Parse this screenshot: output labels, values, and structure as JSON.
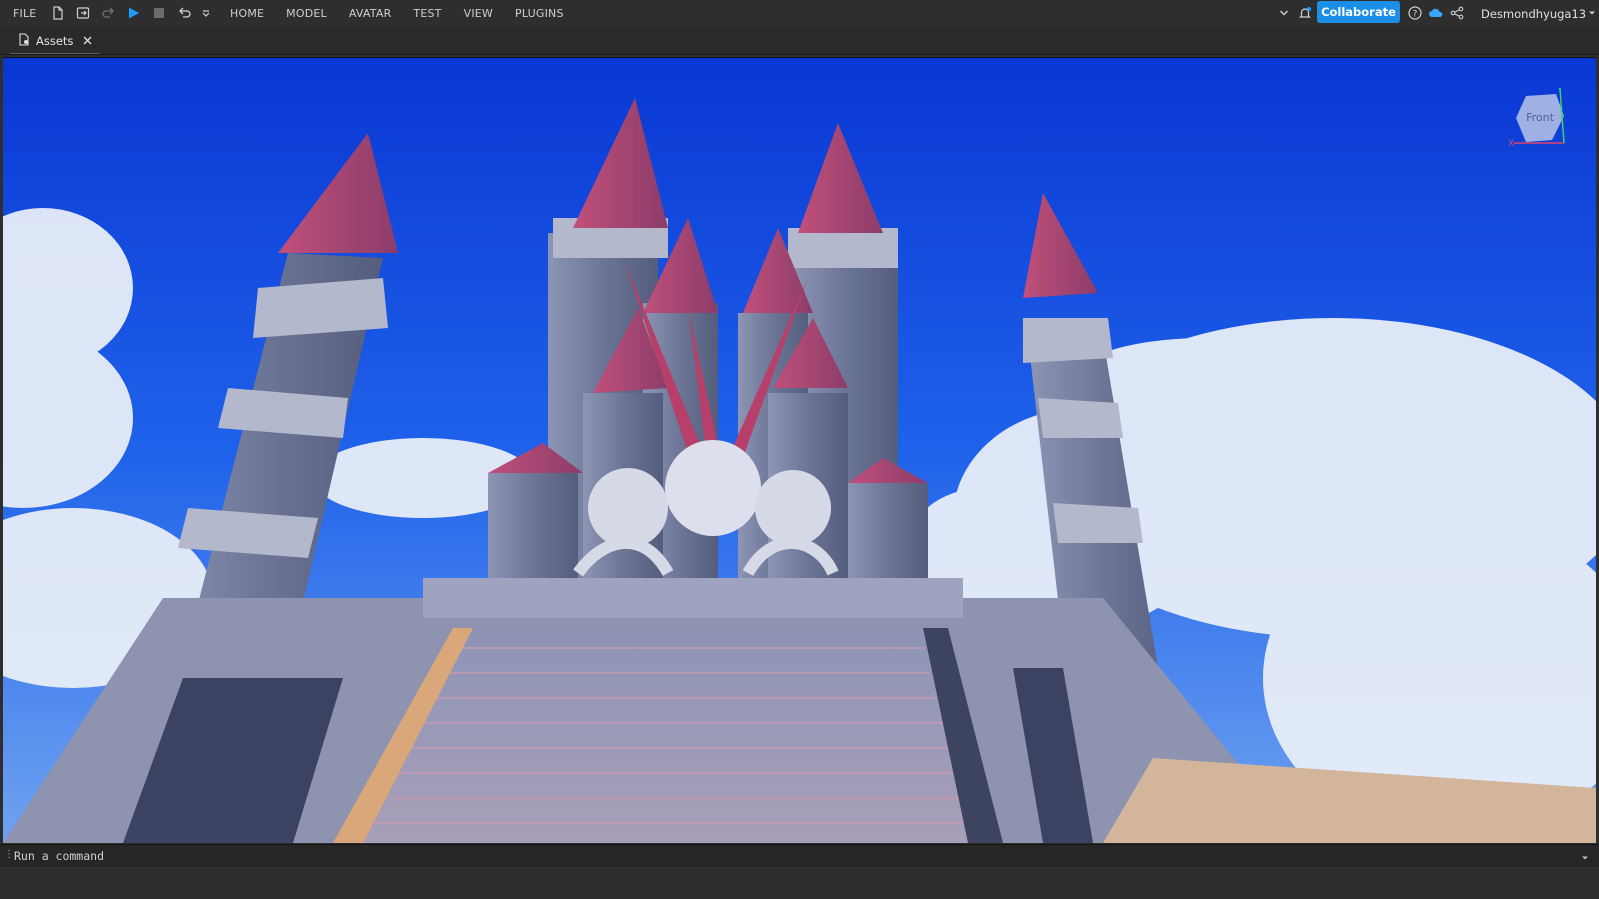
{
  "menu": {
    "file": "FILE",
    "tabs": [
      "HOME",
      "MODEL",
      "AVATAR",
      "TEST",
      "VIEW",
      "PLUGINS"
    ]
  },
  "toolbar": {
    "collaborate": "Collaborate",
    "username": "Desmondhyuga13",
    "accent": "#1b8fe6"
  },
  "tabs": {
    "assets": "Assets"
  },
  "viewport": {
    "view_cube_label": "Front",
    "axis_x": "X",
    "axis_y": "Y"
  },
  "command_bar": {
    "placeholder": "Run a command"
  }
}
